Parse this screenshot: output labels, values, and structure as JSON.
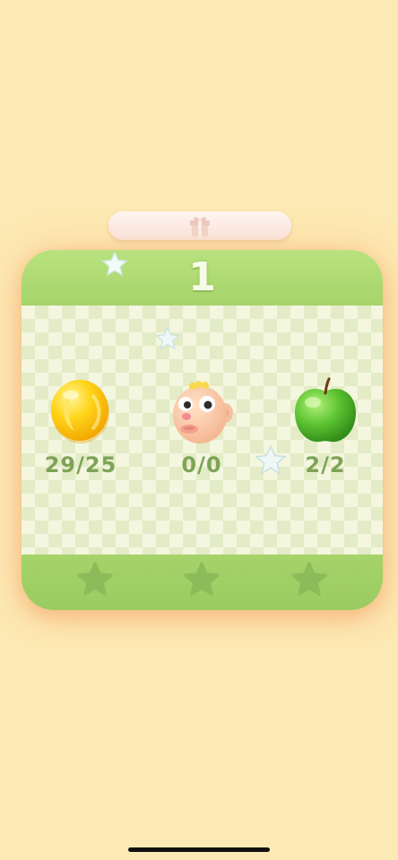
{
  "level": {
    "number": "1"
  },
  "goals": [
    {
      "item": "yellow-candy",
      "count": "29/25"
    },
    {
      "item": "baby-face-piece",
      "count": "0/0"
    },
    {
      "item": "green-apple",
      "count": "2/2"
    }
  ],
  "rating": {
    "stars_earned": 0,
    "stars_total": 3
  },
  "colors": {
    "background": "#fde9b3",
    "header_green": "#b2dc77",
    "count_green": "#7ea357",
    "empty_star": "#8dbb5a"
  }
}
